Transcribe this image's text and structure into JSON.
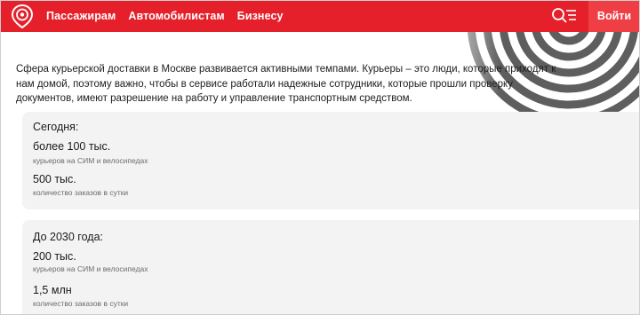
{
  "header": {
    "brand_color": "#e5202a",
    "logo_icon": "location-pin-logo",
    "nav": [
      "Пассажирам",
      "Автомобилистам",
      "Бизнесу"
    ],
    "search_icon": "search-menu-icon",
    "login_label": "Войти"
  },
  "intro": {
    "text": "Сфера курьерской доставки в Москве развивается активными темпами. Курьеры – это люди, которые приходят к нам домой, поэтому важно, чтобы в сервисе работали надежные сотрудники, которые прошли проверку документов, имеют разрешение на работу и управление транспортным средством."
  },
  "cards": [
    {
      "title": "Сегодня:",
      "stats": [
        {
          "value": "более 100 тыс.",
          "label": "курьеров на СИМ и велосипедах"
        },
        {
          "value": "500 тыс.",
          "label": "количество заказов в сутки"
        }
      ]
    },
    {
      "title": "До 2030 года:",
      "stats": [
        {
          "value": "200 тыс.",
          "label": "курьеров на СИМ и велосипедах"
        },
        {
          "value": "1,5 млн",
          "label": "количество заказов в сутки"
        }
      ]
    }
  ]
}
